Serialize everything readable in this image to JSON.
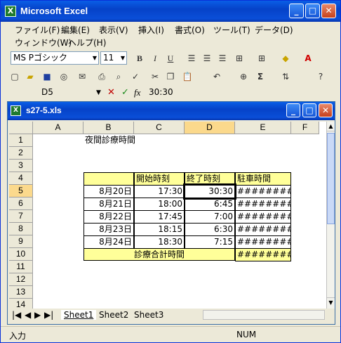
{
  "app": {
    "title": "Microsoft Excel",
    "icon_letter": "X",
    "buttons": {
      "minimize": "_",
      "maximize": "□",
      "close": "✕"
    }
  },
  "menu": {
    "row1": [
      "ファイル(F)",
      "編集(E)",
      "表示(V)",
      "挿入(I)",
      "書式(O)",
      "ツール(T)",
      "データ(D)"
    ],
    "row2": [
      "ウィンドウ(W)",
      "ヘルプ(H)"
    ]
  },
  "format_toolbar": {
    "font": "MS Pゴシック",
    "size": "11",
    "bold": "B",
    "italic": "I",
    "underline": "U"
  },
  "formula_bar": {
    "name_box": "D5",
    "cancel": "✕",
    "enter": "✓",
    "fx": "fx",
    "content": "30:30"
  },
  "workbook": {
    "title": "s27-5.xls",
    "columns": [
      "A",
      "B",
      "C",
      "D",
      "E",
      "F"
    ],
    "rows": [
      "1",
      "2",
      "3",
      "4",
      "5",
      "6",
      "7",
      "8",
      "9",
      "10",
      "11",
      "12",
      "13",
      "14"
    ],
    "cells": {
      "B1": "夜間診療時間",
      "C4": "開始時刻",
      "D4": "終了時刻",
      "E4": "駐車時間",
      "B5": "8月20日",
      "C5": "17:30",
      "D5": "30:30",
      "E5": "#########",
      "B6": "8月21日",
      "C6": "18:00",
      "D6": "6:45",
      "E6": "#########",
      "B7": "8月22日",
      "C7": "17:45",
      "D7": "7:00",
      "E7": "#########",
      "B8": "8月23日",
      "C8": "18:15",
      "D8": "6:30",
      "E8": "#########",
      "B9": "8月24日",
      "C9": "18:30",
      "D9": "7:15",
      "E9": "#########",
      "B10": "診療合計時間",
      "E10": "#########"
    },
    "sheets": [
      "Sheet1",
      "Sheet2",
      "Sheet3"
    ],
    "nav": [
      "|◀",
      "◀",
      "▶",
      "▶|"
    ]
  },
  "status": {
    "mode": "入力",
    "num": "NUM"
  },
  "colors": {
    "header_selected": "#fbd98c",
    "yellow_fill": "#ffff99"
  }
}
